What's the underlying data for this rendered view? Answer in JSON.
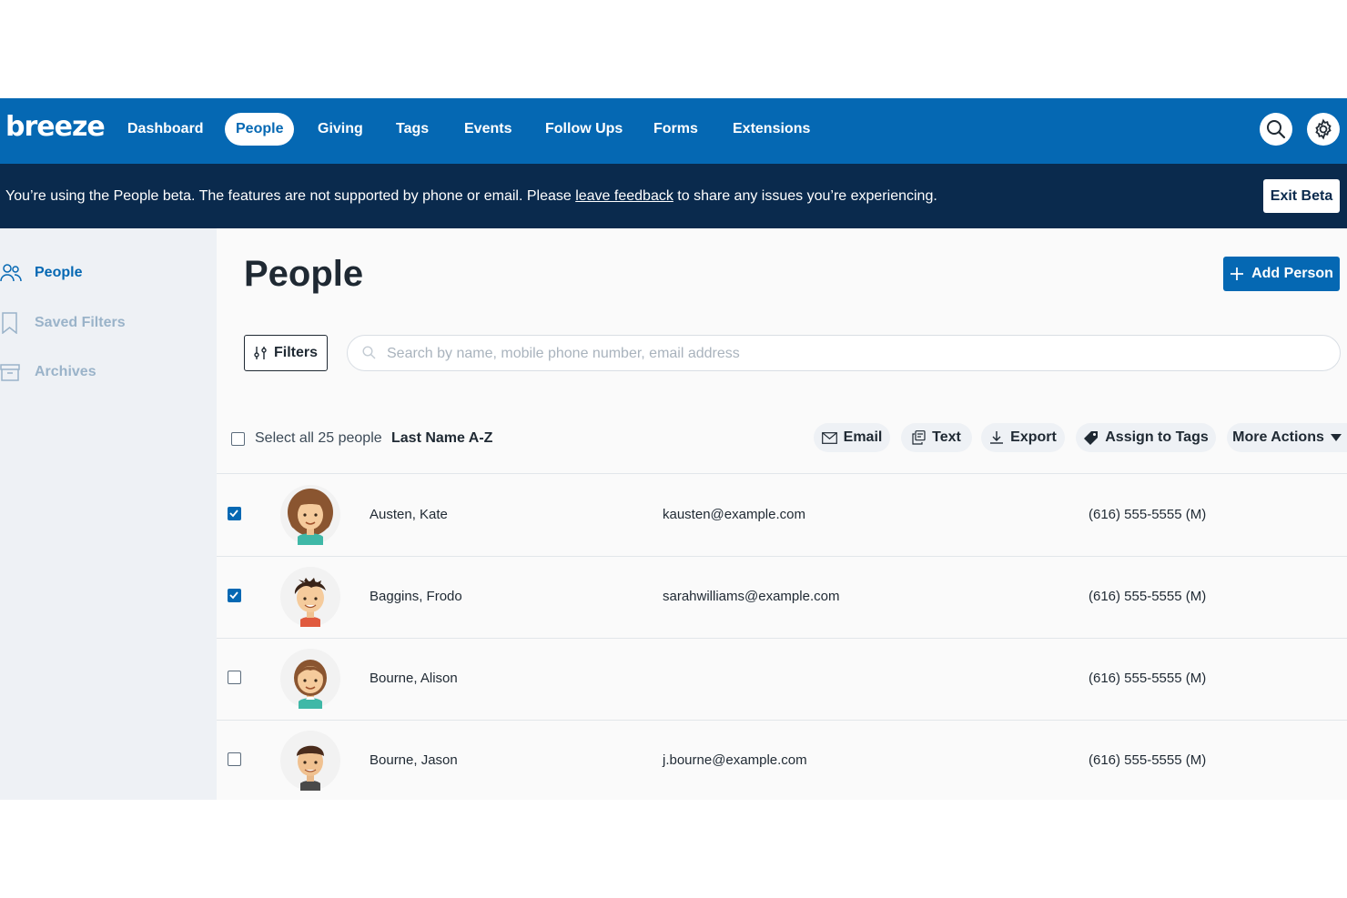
{
  "app": {
    "logo": "breeze",
    "nav": [
      "Dashboard",
      "People",
      "Giving",
      "Tags",
      "Events",
      "Follow Ups",
      "Forms",
      "Extensions"
    ],
    "active_nav": "People",
    "icons": [
      "search-icon",
      "gear-icon"
    ]
  },
  "banner": {
    "text_before": "You’re using the People beta. The features are not supported by phone or email. Please ",
    "link": "leave feedback",
    "text_after": " to share any issues you’re experiencing.",
    "exit_label": "Exit Beta"
  },
  "sidebar": {
    "items": [
      {
        "label": "People",
        "icon": "people-icon",
        "active": true
      },
      {
        "label": "Saved Filters",
        "icon": "bookmark-icon",
        "active": false
      },
      {
        "label": "Archives",
        "icon": "archive-icon",
        "active": false
      }
    ]
  },
  "main": {
    "title": "People",
    "add_person_label": "Add Person",
    "filters_label": "Filters",
    "search_placeholder": "Search by name, mobile phone number, email address",
    "search_value": "",
    "select_all_label": "Select all 25 people",
    "sort_label": "Last Name A-Z",
    "actions": [
      {
        "label": "Email",
        "icon": "envelope-icon"
      },
      {
        "label": "Text",
        "icon": "message-icon"
      },
      {
        "label": "Export",
        "icon": "download-icon"
      },
      {
        "label": "Assign to Tags",
        "icon": "tag-icon"
      },
      {
        "label": "More Actions",
        "icon": "caret-down-icon"
      }
    ]
  },
  "people": [
    {
      "name": "Austen, Kate",
      "email": "kausten@example.com",
      "phone": "(616) 555-5555 (M)",
      "checked": true
    },
    {
      "name": "Baggins, Frodo",
      "email": "sarahwilliams@example.com",
      "phone": "(616) 555-5555 (M)",
      "checked": true
    },
    {
      "name": "Bourne, Alison",
      "email": "",
      "phone": "(616) 555-5555 (M)",
      "checked": false
    },
    {
      "name": "Bourne, Jason",
      "email": "j.bourne@example.com",
      "phone": "(616) 555-5555 (M)",
      "checked": false
    }
  ],
  "colors": {
    "brand": "#0568b3",
    "banner": "#0a2a4d",
    "sidebar_active": "#0568b3",
    "sidebar_inactive": "#9ab3c9"
  }
}
